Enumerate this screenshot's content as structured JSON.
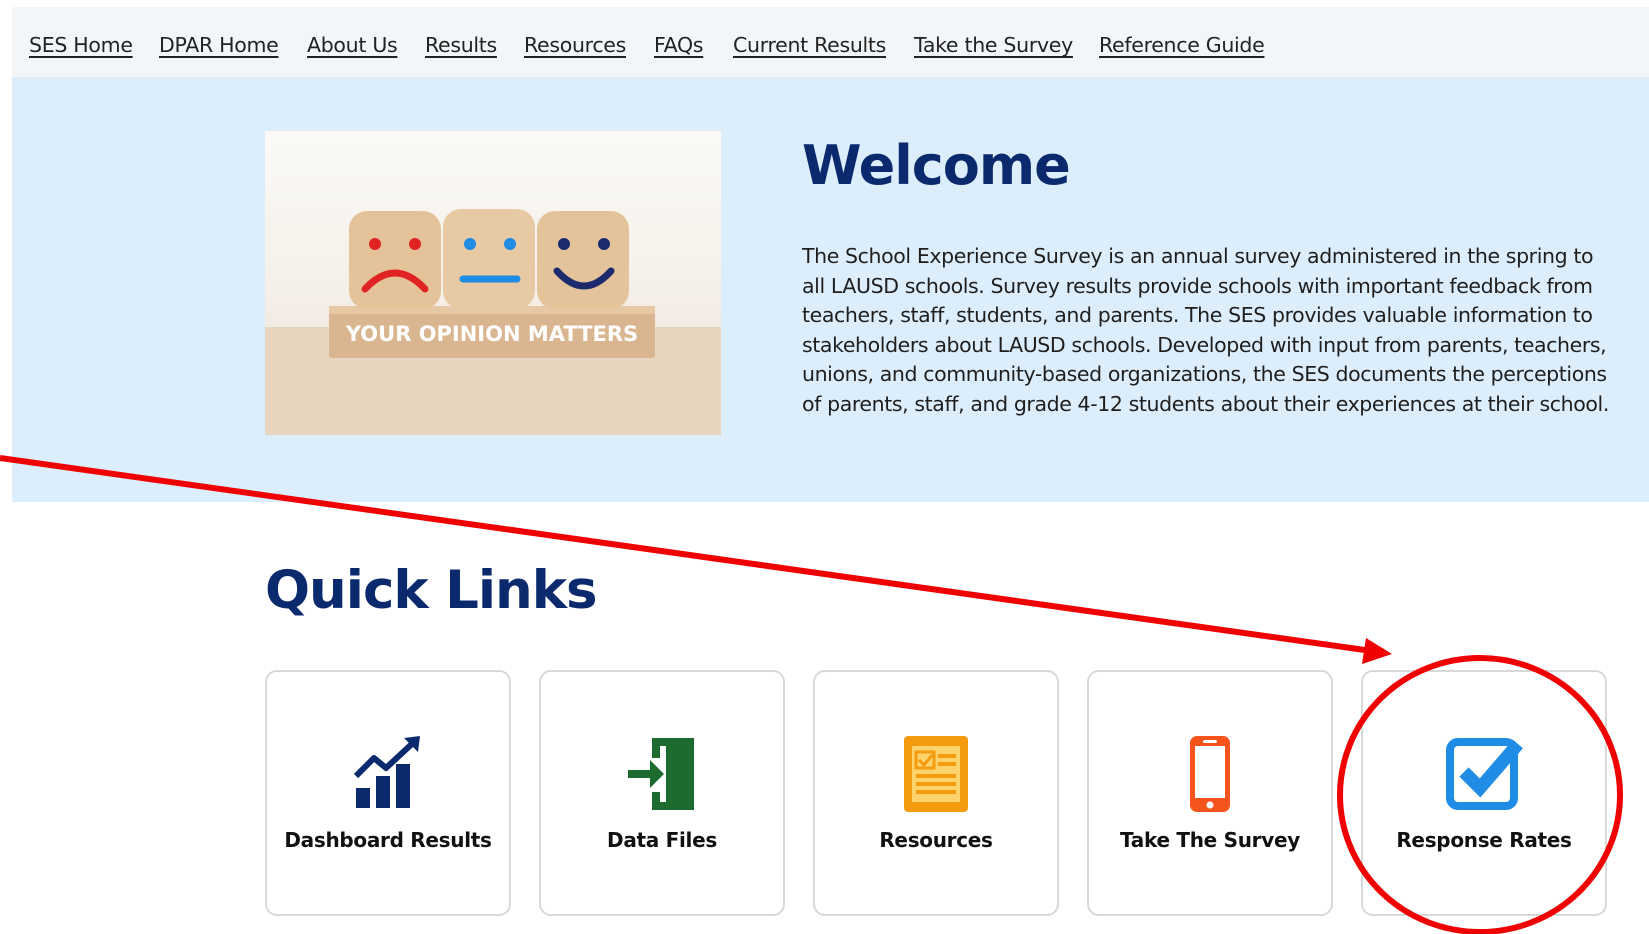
{
  "nav": {
    "links": [
      "SES Home",
      "DPAR Home",
      "About Us",
      "Results",
      "Resources",
      "FAQs",
      "Current Results",
      "Take the Survey",
      "Reference Guide"
    ]
  },
  "hero": {
    "image_text": "YOUR OPINION MATTERS",
    "title": "Welcome",
    "body": "The School Experience Survey is an annual survey administered in the spring to all LAUSD schools. Survey results provide schools with important feedback from teachers, staff, students, and parents. The SES provides valuable information to stakeholders about LAUSD schools. Developed with input from parents, teachers, unions, and community-based organizations, the SES documents the perceptions of parents, staff, and grade 4-12 students about their experiences at their school."
  },
  "quick_links": {
    "title": "Quick Links",
    "cards": [
      {
        "label": "Dashboard Results",
        "icon": "chart-growth-icon"
      },
      {
        "label": "Data Files",
        "icon": "file-enter-icon"
      },
      {
        "label": "Resources",
        "icon": "document-icon"
      },
      {
        "label": "Take The Survey",
        "icon": "mobile-phone-icon"
      },
      {
        "label": "Response Rates",
        "icon": "checkbox-icon"
      }
    ]
  },
  "colors": {
    "navy": "#0b2a6e",
    "hero_bg": "#dcedfb",
    "green": "#1c6b2f",
    "orange": "#f59b10",
    "phone_orange": "#f5551d",
    "check_blue": "#1f8ce6",
    "annotation_red": "#f00000"
  }
}
